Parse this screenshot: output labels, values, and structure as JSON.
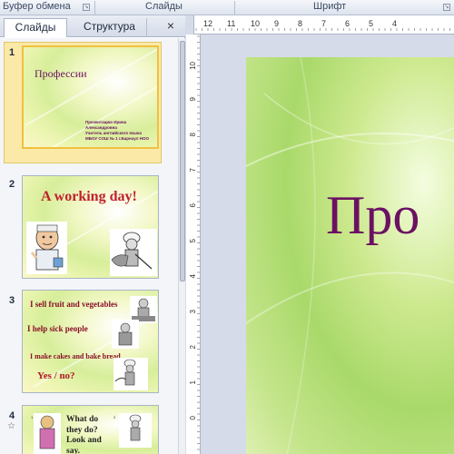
{
  "ribbon": {
    "groups": [
      "Буфер обмена",
      "Слайды",
      "Шрифт"
    ]
  },
  "panel": {
    "tabs": [
      "Слайды",
      "Структура"
    ],
    "close_glyph": "×"
  },
  "ruler": {
    "h_labels": [
      "12",
      "11",
      "10",
      "9",
      "8",
      "7",
      "6",
      "5",
      "4"
    ],
    "v_labels": [
      "10",
      "9",
      "8",
      "7",
      "6",
      "5",
      "4",
      "3",
      "2",
      "1",
      "0"
    ]
  },
  "slides": [
    {
      "number": "1",
      "title": "Профессии",
      "caption": [
        "Презентацию Ирина",
        "Александровна",
        "Учитель английского языка",
        "МБОУ СОШ № 1 г.Барнаул НОО"
      ]
    },
    {
      "number": "2",
      "title": "A working day!"
    },
    {
      "number": "3",
      "lines": [
        "I sell  fruit  and vegetables",
        "I help  sick people",
        "I make  cakes  and  bake  bread",
        "Yes / no?"
      ]
    },
    {
      "number": "4",
      "text": [
        "What do",
        "they do?",
        "Look and",
        "say."
      ],
      "markers": [
        "1",
        "2",
        "3",
        "4"
      ],
      "star_glyph": "☆"
    }
  ],
  "editor": {
    "title_visible": "Про"
  },
  "colors": {
    "title_purple": "#6b1162",
    "slide2_title": "#c0202a",
    "slide3_text": "#8a1028",
    "slide3_answer": "#b0182a"
  }
}
